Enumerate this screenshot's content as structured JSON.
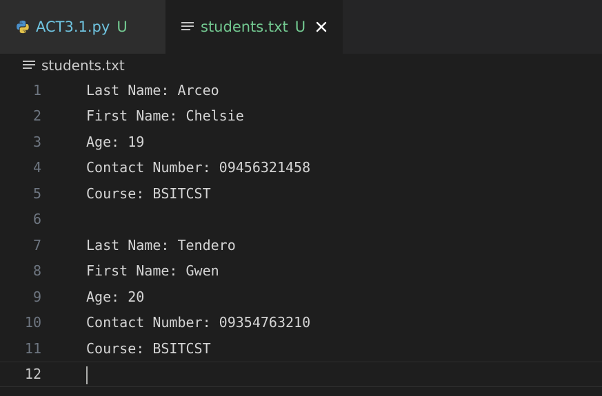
{
  "tabs": [
    {
      "name": "ACT3.1.py",
      "status": "U",
      "icon": "python-icon",
      "active": false
    },
    {
      "name": "students.txt",
      "status": "U",
      "icon": "text-file-icon",
      "active": true,
      "close": "×"
    }
  ],
  "breadcrumb": {
    "icon": "text-file-icon",
    "label": "students.txt"
  },
  "editor": {
    "current_line": 12,
    "lines": [
      {
        "num": "1",
        "text": "Last Name: Arceo"
      },
      {
        "num": "2",
        "text": "First Name: Chelsie"
      },
      {
        "num": "3",
        "text": "Age: 19"
      },
      {
        "num": "4",
        "text": "Contact Number: 09456321458"
      },
      {
        "num": "5",
        "text": "Course: BSITCST"
      },
      {
        "num": "6",
        "text": ""
      },
      {
        "num": "7",
        "text": "Last Name: Tendero"
      },
      {
        "num": "8",
        "text": "First Name: Gwen"
      },
      {
        "num": "9",
        "text": "Age: 20"
      },
      {
        "num": "10",
        "text": "Contact Number: 09354763210"
      },
      {
        "num": "11",
        "text": "Course: BSITCST"
      },
      {
        "num": "12",
        "text": ""
      }
    ]
  },
  "colors": {
    "editor_bg": "#1e1e1e",
    "tab_bar_bg": "#252526",
    "inactive_tab_bg": "#2d2d2d",
    "untracked_green": "#73c991",
    "python_blue": "#6fc3df",
    "text": "#d4d4d4",
    "line_number": "#6e7681"
  }
}
